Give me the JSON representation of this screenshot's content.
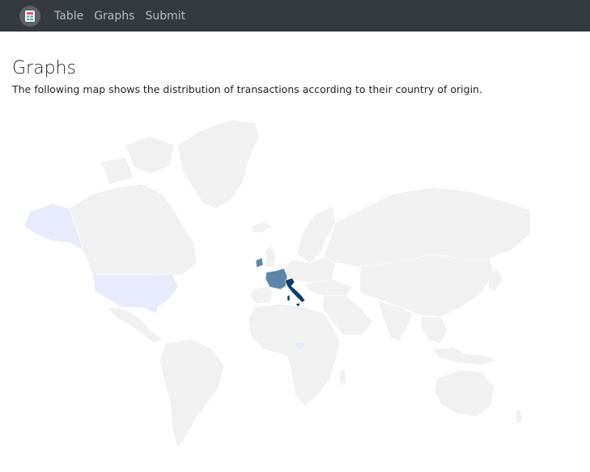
{
  "nav": {
    "brand_icon": "app-logo-icon",
    "links": [
      "Table",
      "Graphs",
      "Submit"
    ]
  },
  "page": {
    "title": "Graphs",
    "description": "The following map shows the distribution of transactions according to their country of origin."
  },
  "map": {
    "type": "choropleth",
    "projection": "world",
    "colors": {
      "no_data": "#f1f1f1",
      "low": "#e8ebfb",
      "mid": "#5f85ab",
      "high": "#0c3c6a"
    },
    "countries": [
      {
        "name": "Italy",
        "level": "high"
      },
      {
        "name": "France",
        "level": "mid"
      },
      {
        "name": "Ireland",
        "level": "mid"
      },
      {
        "name": "United States",
        "level": "low"
      },
      {
        "name": "Alaska",
        "level": "low"
      },
      {
        "name": "Nigeria",
        "level": "low"
      }
    ]
  }
}
